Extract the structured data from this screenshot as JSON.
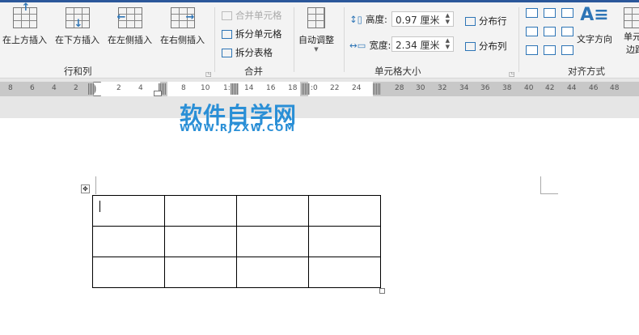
{
  "ribbon": {
    "rows_cols": {
      "label": "行和列",
      "buttons": [
        "在上方插入",
        "在下方插入",
        "在左侧插入",
        "在右侧插入"
      ]
    },
    "merge": {
      "label": "合并",
      "buttons": [
        "合并单元格",
        "拆分单元格",
        "拆分表格"
      ]
    },
    "cell_size": {
      "label": "单元格大小",
      "autofit": "自动调整",
      "height_label": "高度:",
      "height_value": "0.97 厘米",
      "width_label": "宽度:",
      "width_value": "2.34 厘米",
      "distribute_rows": "分布行",
      "distribute_cols": "分布列"
    },
    "alignment": {
      "label": "对齐方式",
      "text_direction": "文字方向",
      "cell_margins_1": "单元",
      "cell_margins_2": "边距"
    }
  },
  "ruler": {
    "ticks_left": [
      "8",
      "6",
      "4",
      "2"
    ],
    "ticks_mid": [
      "2",
      "4",
      "8",
      "10",
      "1:",
      "14",
      "16",
      "18",
      ":0",
      "22",
      "24"
    ],
    "ticks_right": [
      "28",
      "30",
      "32",
      "34",
      "36",
      "38",
      "40",
      "42",
      "44",
      "46",
      "48"
    ]
  },
  "watermark": {
    "title": "软件自学网",
    "url": "WWW.RJZXW.COM"
  },
  "table": {
    "rows": 3,
    "cols": 4
  }
}
